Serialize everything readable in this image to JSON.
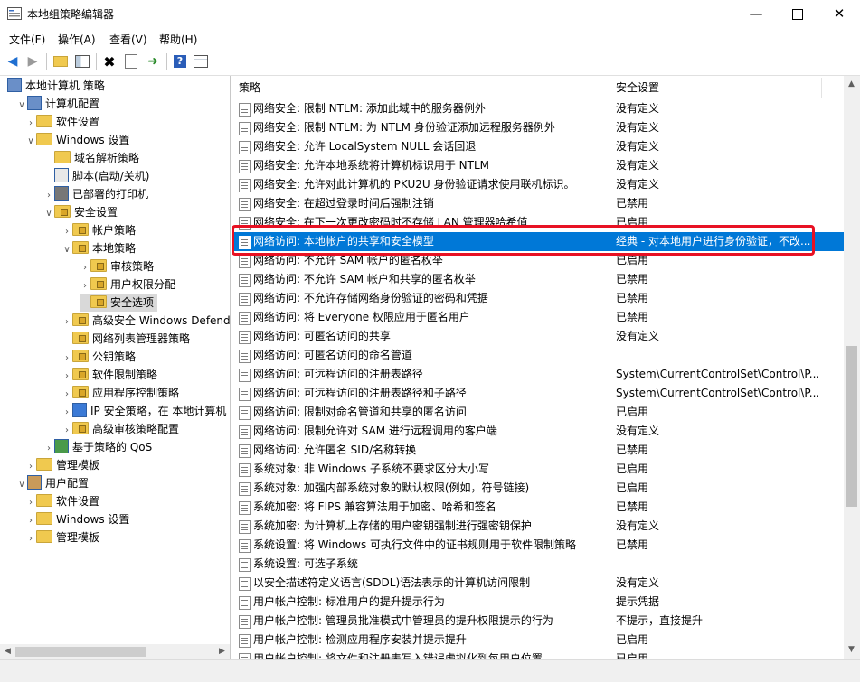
{
  "window": {
    "title": "本地组策略编辑器",
    "min_icon": "minimize-icon",
    "max_icon": "maximize-icon",
    "close_icon": "close-icon"
  },
  "menu": [
    "文件(F)",
    "操作(A)",
    "查看(V)",
    "帮助(H)"
  ],
  "toolbar": [
    "back-icon",
    "forward-icon",
    "up-folder-icon",
    "show-hide-tree-icon",
    "delete-icon",
    "properties-icon",
    "export-icon",
    "help-icon",
    "view-icon"
  ],
  "tree": [
    {
      "label": "本地计算机 策略",
      "level": 0,
      "caret": "",
      "icon": "computer"
    },
    {
      "label": "计算机配置",
      "level": 1,
      "caret": "open",
      "icon": "computer"
    },
    {
      "label": "软件设置",
      "level": 2,
      "caret": "closed",
      "icon": "folder"
    },
    {
      "label": "Windows 设置",
      "level": 2,
      "caret": "open",
      "icon": "folder"
    },
    {
      "label": "域名解析策略",
      "level": 3,
      "caret": "",
      "icon": "folder"
    },
    {
      "label": "脚本(启动/关机)",
      "level": 3,
      "caret": "",
      "icon": "script"
    },
    {
      "label": "已部署的打印机",
      "level": 3,
      "caret": "closed",
      "icon": "printer"
    },
    {
      "label": "安全设置",
      "level": 3,
      "caret": "open",
      "icon": "folder-lock"
    },
    {
      "label": "帐户策略",
      "level": 4,
      "caret": "closed",
      "icon": "folder-lock"
    },
    {
      "label": "本地策略",
      "level": 4,
      "caret": "open",
      "icon": "folder-lock"
    },
    {
      "label": "审核策略",
      "level": 5,
      "caret": "closed",
      "icon": "folder-lock"
    },
    {
      "label": "用户权限分配",
      "level": 5,
      "caret": "closed",
      "icon": "folder-lock"
    },
    {
      "label": "安全选项",
      "level": 5,
      "caret": "",
      "icon": "folder-lock",
      "selected": true
    },
    {
      "label": "高级安全 Windows Defender 防火墙",
      "level": 4,
      "caret": "closed",
      "icon": "folder-lock"
    },
    {
      "label": "网络列表管理器策略",
      "level": 4,
      "caret": "",
      "icon": "folder-lock"
    },
    {
      "label": "公钥策略",
      "level": 4,
      "caret": "closed",
      "icon": "folder-lock"
    },
    {
      "label": "软件限制策略",
      "level": 4,
      "caret": "closed",
      "icon": "folder-lock"
    },
    {
      "label": "应用程序控制策略",
      "level": 4,
      "caret": "closed",
      "icon": "folder-lock"
    },
    {
      "label": "IP 安全策略，在 本地计算机",
      "level": 4,
      "caret": "closed",
      "icon": "ipsec"
    },
    {
      "label": "高级审核策略配置",
      "level": 4,
      "caret": "closed",
      "icon": "folder-lock"
    },
    {
      "label": "基于策略的 QoS",
      "level": 3,
      "caret": "closed",
      "icon": "chart"
    },
    {
      "label": "管理模板",
      "level": 2,
      "caret": "closed",
      "icon": "folder"
    },
    {
      "label": "用户配置",
      "level": 1,
      "caret": "open",
      "icon": "user"
    },
    {
      "label": "软件设置",
      "level": 2,
      "caret": "closed",
      "icon": "folder"
    },
    {
      "label": "Windows 设置",
      "level": 2,
      "caret": "closed",
      "icon": "folder"
    },
    {
      "label": "管理模板",
      "level": 2,
      "caret": "closed",
      "icon": "folder"
    }
  ],
  "list": {
    "col_policy": "策略",
    "col_setting": "安全设置",
    "rows": [
      {
        "policy": "网络安全: 限制 NTLM: 添加此域中的服务器例外",
        "setting": "没有定义"
      },
      {
        "policy": "网络安全: 限制 NTLM: 为 NTLM 身份验证添加远程服务器例外",
        "setting": "没有定义"
      },
      {
        "policy": "网络安全: 允许 LocalSystem NULL 会话回退",
        "setting": "没有定义"
      },
      {
        "policy": "网络安全: 允许本地系统将计算机标识用于 NTLM",
        "setting": "没有定义"
      },
      {
        "policy": "网络安全: 允许对此计算机的 PKU2U 身份验证请求使用联机标识。",
        "setting": "没有定义"
      },
      {
        "policy": "网络安全: 在超过登录时间后强制注销",
        "setting": "已禁用"
      },
      {
        "policy": "网络安全: 在下一次更改密码时不存储 LAN 管理器哈希值",
        "setting": "已启用"
      },
      {
        "policy": "网络访问: 本地帐户的共享和安全模型",
        "setting": "经典 - 对本地用户进行身份验证，不改...",
        "selected": true
      },
      {
        "policy": "网络访问: 不允许 SAM 帐户的匿名枚举",
        "setting": "已启用"
      },
      {
        "policy": "网络访问: 不允许 SAM 帐户和共享的匿名枚举",
        "setting": "已禁用"
      },
      {
        "policy": "网络访问: 不允许存储网络身份验证的密码和凭据",
        "setting": "已禁用"
      },
      {
        "policy": "网络访问: 将 Everyone 权限应用于匿名用户",
        "setting": "已禁用"
      },
      {
        "policy": "网络访问: 可匿名访问的共享",
        "setting": "没有定义"
      },
      {
        "policy": "网络访问: 可匿名访问的命名管道",
        "setting": ""
      },
      {
        "policy": "网络访问: 可远程访问的注册表路径",
        "setting": "System\\CurrentControlSet\\Control\\P..."
      },
      {
        "policy": "网络访问: 可远程访问的注册表路径和子路径",
        "setting": "System\\CurrentControlSet\\Control\\P..."
      },
      {
        "policy": "网络访问: 限制对命名管道和共享的匿名访问",
        "setting": "已启用"
      },
      {
        "policy": "网络访问: 限制允许对 SAM 进行远程调用的客户端",
        "setting": "没有定义"
      },
      {
        "policy": "网络访问: 允许匿名 SID/名称转换",
        "setting": "已禁用"
      },
      {
        "policy": "系统对象: 非 Windows 子系统不要求区分大小写",
        "setting": "已启用"
      },
      {
        "policy": "系统对象: 加强内部系统对象的默认权限(例如，符号链接)",
        "setting": "已启用"
      },
      {
        "policy": "系统加密: 将 FIPS 兼容算法用于加密、哈希和签名",
        "setting": "已禁用"
      },
      {
        "policy": "系统加密: 为计算机上存储的用户密钥强制进行强密钥保护",
        "setting": "没有定义"
      },
      {
        "policy": "系统设置: 将 Windows 可执行文件中的证书规则用于软件限制策略",
        "setting": "已禁用"
      },
      {
        "policy": "系统设置: 可选子系统",
        "setting": ""
      },
      {
        "policy": "以安全描述符定义语言(SDDL)语法表示的计算机访问限制",
        "setting": "没有定义"
      },
      {
        "policy": "用户帐户控制: 标准用户的提升提示行为",
        "setting": "提示凭据"
      },
      {
        "policy": "用户帐户控制: 管理员批准模式中管理员的提升权限提示的行为",
        "setting": "不提示，直接提升"
      },
      {
        "policy": "用户帐户控制: 检测应用程序安装并提示提升",
        "setting": "已启用"
      },
      {
        "policy": "用户帐户控制: 将文件和注册表写入错误虚拟化到每用户位置",
        "setting": "已启用"
      }
    ]
  }
}
